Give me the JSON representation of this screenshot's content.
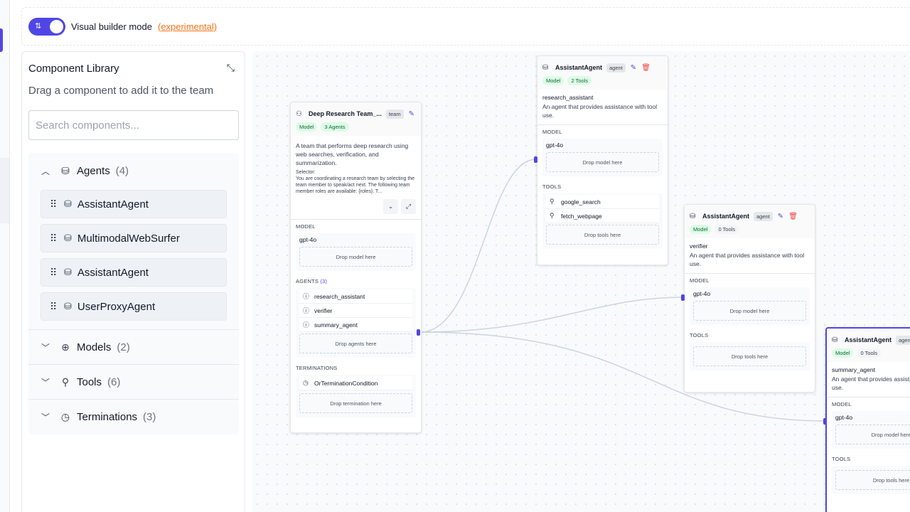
{
  "toolbar": {
    "builder_label": "Visual builder mode",
    "experimental_label": "(experimental)",
    "toggle_glyph": "⇅"
  },
  "library": {
    "title": "Component Library",
    "subtitle": "Drag a component to add it to the team",
    "search_placeholder": "Search components...",
    "sections": {
      "agents": {
        "name": "Agents",
        "count": "(4)",
        "expanded": true
      },
      "models": {
        "name": "Models",
        "count": "(2)",
        "expanded": false
      },
      "tools": {
        "name": "Tools",
        "count": "(6)",
        "expanded": false
      },
      "terminations": {
        "name": "Terminations",
        "count": "(3)",
        "expanded": false
      }
    },
    "agent_items": [
      "AssistantAgent",
      "MultimodalWebSurfer",
      "AssistantAgent",
      "UserProxyAgent"
    ]
  },
  "team_node": {
    "title": "Deep Research Team_...",
    "badge": "team",
    "pills": [
      "Model",
      "3 Agents"
    ],
    "description": "A team that performs deep research using web searches, verification, and summarization.",
    "selector_label": "Selector:",
    "selector_text": "You are coordinating a research team by selecting the team member to speak/act next. The following team member roles are available: {roles}. T...",
    "model_label": "MODEL",
    "model_value": "gpt-4o",
    "drop_model": "Drop model here",
    "agents_label": "AGENTS",
    "agents_count": "(3)",
    "agents": [
      "research_assistant",
      "verifier",
      "summary_agent"
    ],
    "drop_agents": "Drop agents here",
    "terminations_label": "TERMINATIONS",
    "termination": "OrTerminationCondition",
    "drop_termination": "Drop termination here"
  },
  "agent_nodes": [
    {
      "title": "AssistantAgent",
      "badge": "agent",
      "pills": [
        "Model",
        "2 Tools"
      ],
      "name": "research_assistant",
      "description": "An agent that provides assistance with tool use.",
      "model_label": "MODEL",
      "model_value": "gpt-4o",
      "drop_model": "Drop model here",
      "tools_label": "TOOLS",
      "tools": [
        "google_search",
        "fetch_webpage"
      ],
      "drop_tools": "Drop tools here"
    },
    {
      "title": "AssistantAgent",
      "badge": "agent",
      "pills": [
        "Model",
        "0 Tools"
      ],
      "name": "verifier",
      "description": "An agent that provides assistance with tool use.",
      "model_label": "MODEL",
      "model_value": "gpt-4o",
      "drop_model": "Drop model here",
      "tools_label": "TOOLS",
      "drop_tools": "Drop tools here"
    },
    {
      "title": "AssistantAgent",
      "badge": "agent",
      "pills": [
        "Model",
        "0 Tools"
      ],
      "name": "summary_agent",
      "description": "An agent that provides assistance with tool use.",
      "model_label": "MODEL",
      "model_value": "gpt-4o",
      "drop_model": "Drop model here",
      "tools_label": "TOOLS",
      "drop_tools": "Drop tools here"
    }
  ],
  "colors": {
    "accent": "#4f46e5",
    "link": "#f97316",
    "pill_bg": "#dcfce7",
    "pill_text": "#166534",
    "delete": "#ef4444"
  }
}
